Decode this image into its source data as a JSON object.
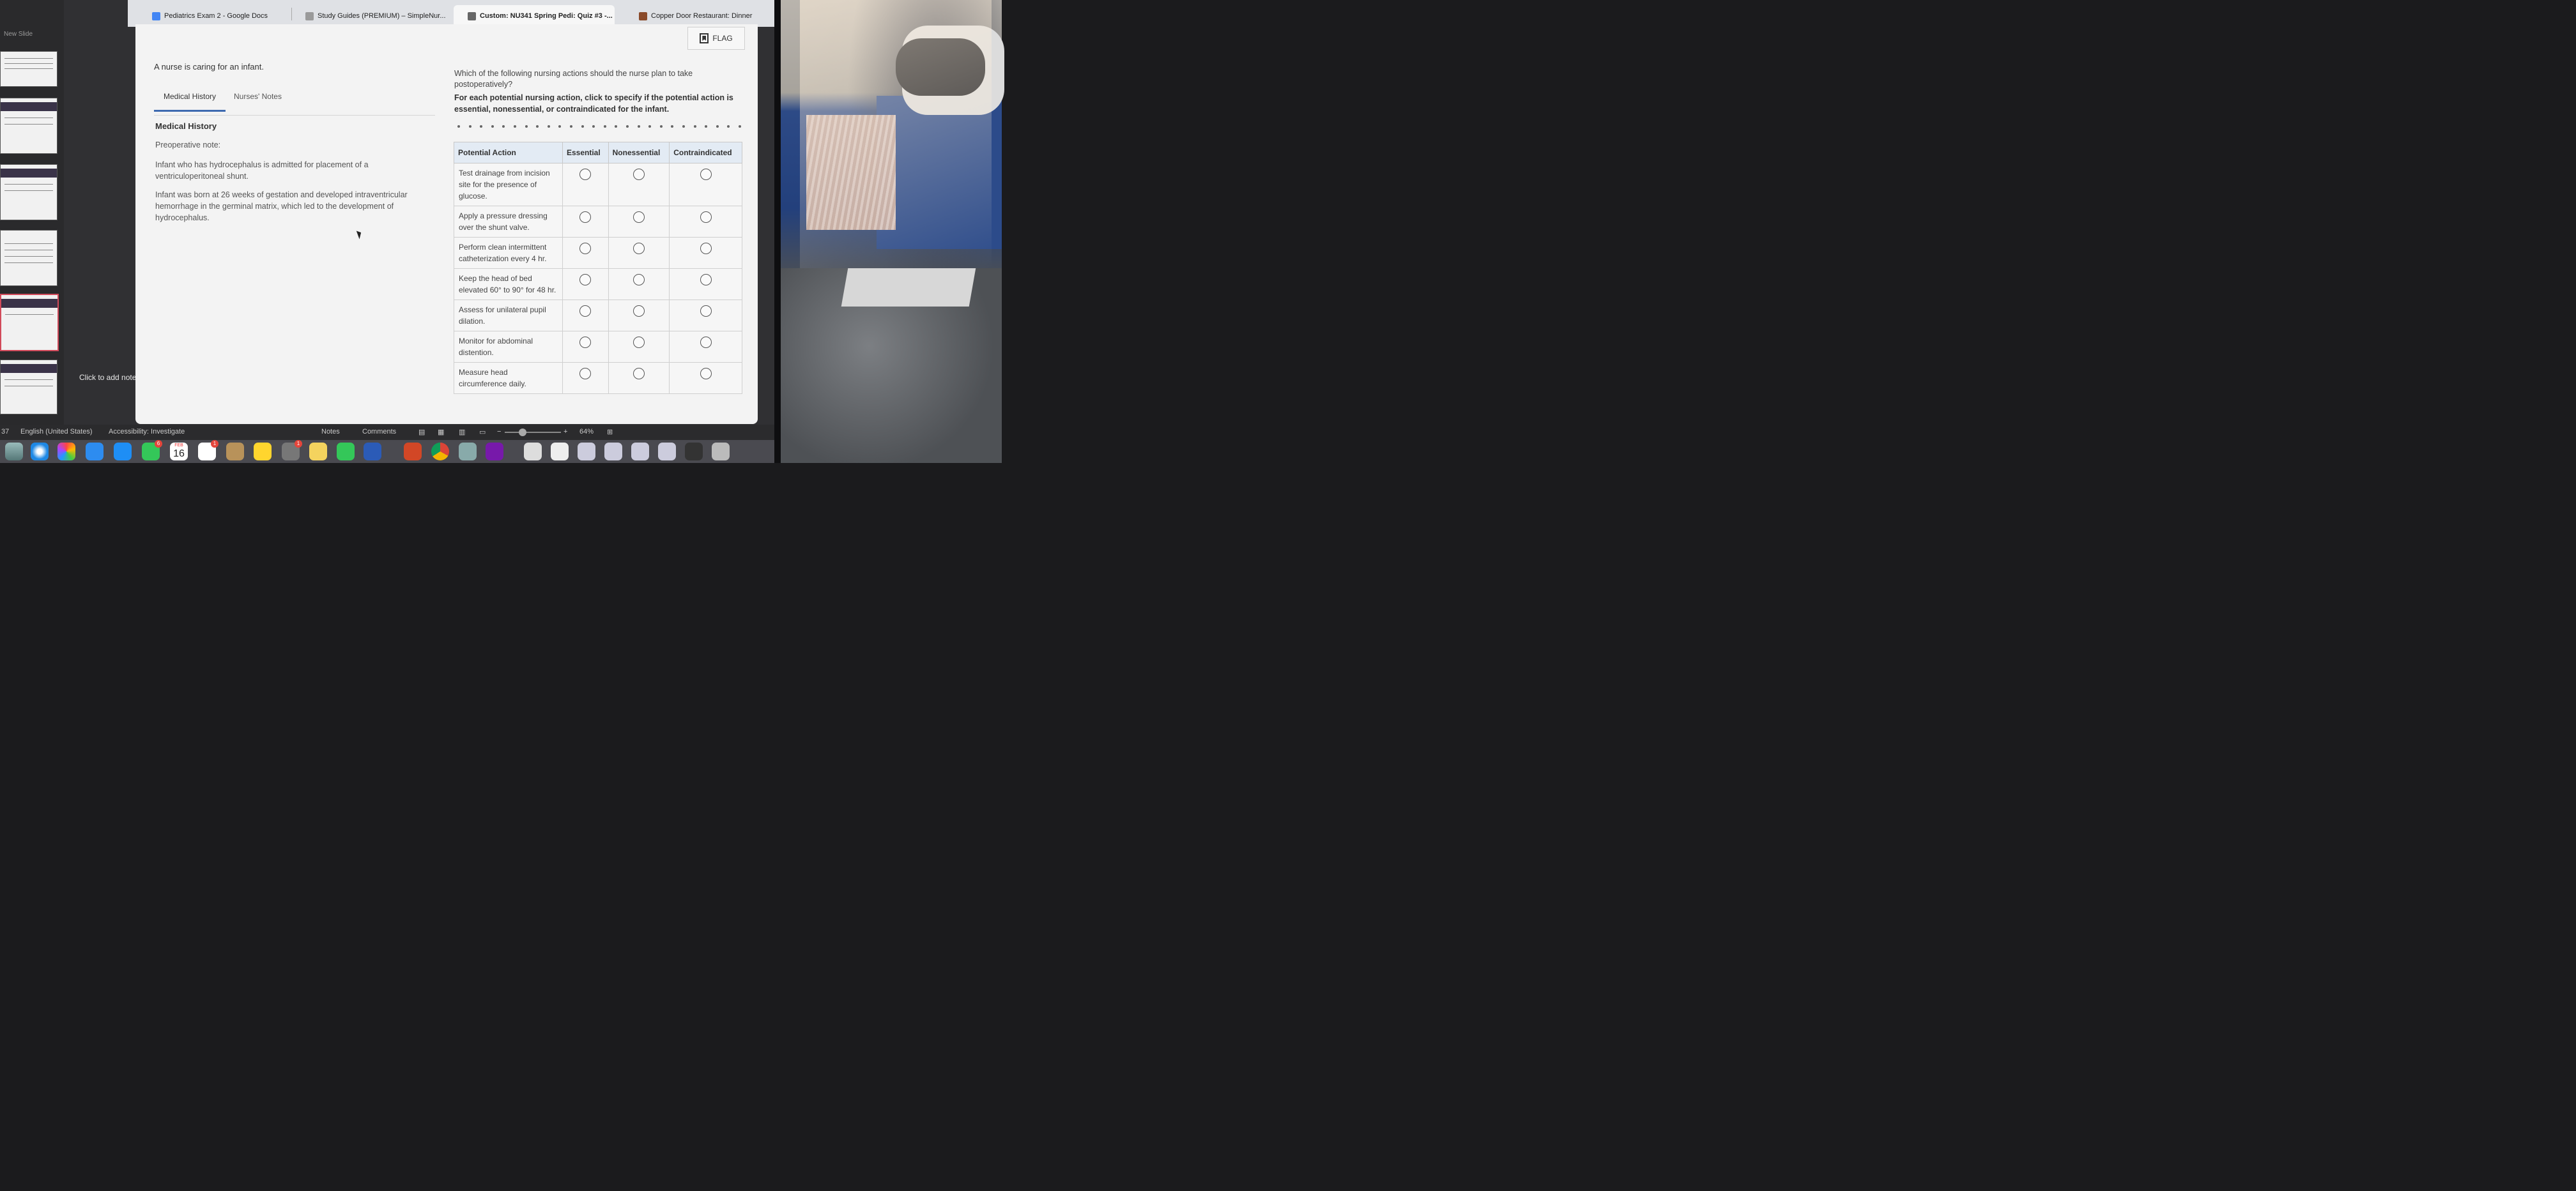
{
  "browser_tabs": [
    {
      "label": "Pediatrics Exam 2 - Google Docs",
      "icon": "google-docs-icon",
      "color": "#4285f4"
    },
    {
      "label": "Study Guides (PREMIUM) – SimpleNur...",
      "icon": "simplenursing-icon",
      "color": "#888888"
    },
    {
      "label": "Custom: NU341 Spring Pedi: Quiz #3 -...",
      "icon": "document-icon",
      "color": "#555555"
    },
    {
      "label": "Copper Door Restaurant: Dinner",
      "icon": "restaurant-icon",
      "color": "#8a4a2a"
    }
  ],
  "ppt": {
    "new_slide": "New Slide",
    "click_to_add_notes": "Click to add note",
    "status": {
      "slide_count": "37",
      "language": "English (United States)",
      "accessibility": "Accessibility: Investigate",
      "notes": "Notes",
      "comments": "Comments",
      "zoom": "64%"
    }
  },
  "exam": {
    "flag_label": "FLAG",
    "scenario": "A nurse is caring for an infant.",
    "tabs": [
      "Medical History",
      "Nurses' Notes"
    ],
    "section_title": "Medical History",
    "preop_label": "Preoperative note:",
    "paragraphs": [
      "Infant who has hydrocephalus is admitted for placement of a ventriculoperitoneal shunt.",
      "Infant was born at 26 weeks of gestation and developed intraventricular hemorrhage in the germinal matrix, which led to the development of hydrocephalus."
    ],
    "question": "Which of the following nursing actions should the nurse plan to take postoperatively?",
    "instruction": "For each potential nursing action, click to specify if the potential action is essential, nonessential, or contraindicated for the infant.",
    "columns": [
      "Potential Action",
      "Essential",
      "Nonessential",
      "Contraindicated"
    ],
    "rows": [
      "Test drainage from incision site for the presence of glucose.",
      "Apply a pressure dressing over the shunt valve.",
      "Perform clean intermittent catheterization every 4 hr.",
      "Keep the head of bed elevated 60° to 90° for 48 hr.",
      "Assess for unilateral pupil dilation.",
      "Monitor for abdominal distention.",
      "Measure head circumference daily."
    ]
  },
  "dock": {
    "calendar_month": "FEB",
    "calendar_day": "16",
    "badges": {
      "facetime": "6",
      "reminders": "1",
      "settings": "1"
    }
  }
}
